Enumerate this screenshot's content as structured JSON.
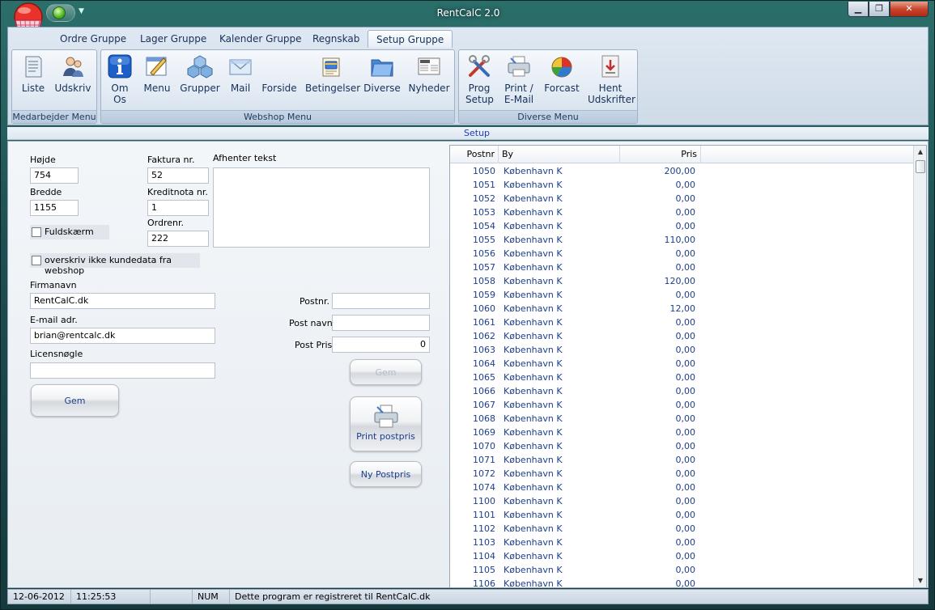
{
  "window": {
    "title": "RentCalC 2.0",
    "min_glyph": "▁",
    "max_glyph": "❐",
    "close_glyph": "✕",
    "qat_drop_glyph": "▼"
  },
  "ribbon": {
    "tabs": [
      "Ordre Gruppe",
      "Lager Gruppe",
      "Kalender Gruppe",
      "Regnskab",
      "Setup Gruppe"
    ],
    "active_tab": "Setup Gruppe",
    "groups": {
      "medarbejder": {
        "label": "Medarbejder Menu",
        "buttons": [
          "Liste",
          "Udskriv"
        ]
      },
      "webshop": {
        "label": "Webshop Menu",
        "buttons": [
          "Om Os",
          "Menu",
          "Grupper",
          "Mail",
          "Forside",
          "Betingelser",
          "Diverse",
          "Nyheder"
        ]
      },
      "diverse": {
        "label": "Diverse Menu",
        "buttons": [
          "Prog Setup",
          "Print / E-Mail",
          "Forcast",
          "Hent Udskrifter"
        ]
      }
    }
  },
  "section_label": "Setup",
  "form": {
    "hojde_label": "Højde",
    "hojde_value": "754",
    "bredde_label": "Bredde",
    "bredde_value": "1155",
    "fuldskaerm_label": "Fuldskærm",
    "faktura_label": "Faktura nr.",
    "faktura_value": "52",
    "kreditnota_label": "Kreditnota nr.",
    "kreditnota_value": "1",
    "ordrenr_label": "Ordrenr.",
    "ordrenr_value": "222",
    "afhenter_label": "Afhenter tekst",
    "afhenter_value": "",
    "overskriv_label": "overskriv ikke kundedata fra webshop",
    "firmanavn_label": "Firmanavn",
    "firmanavn_value": "RentCalC.dk",
    "email_label": "E-mail adr.",
    "email_value": "brian@rentcalc.dk",
    "licens_label": "Licensnøgle",
    "licens_value": "",
    "gem_label": "Gem",
    "postnr_label": "Postnr.",
    "postnr_value": "",
    "postnavn_label": "Post navn",
    "postnavn_value": "",
    "postpris_label": "Post Pris",
    "postpris_value": "0",
    "gem2_label": "Gem",
    "print_postpris_label": "Print postpris",
    "ny_postpris_label": "Ny Postpris"
  },
  "grid": {
    "headers": {
      "postnr": "Postnr",
      "by": "By",
      "pris": "Pris"
    },
    "rows": [
      {
        "postnr": "1050",
        "by": "København K",
        "pris": "200,00"
      },
      {
        "postnr": "1051",
        "by": "København K",
        "pris": "0,00"
      },
      {
        "postnr": "1052",
        "by": "København K",
        "pris": "0,00"
      },
      {
        "postnr": "1053",
        "by": "København K",
        "pris": "0,00"
      },
      {
        "postnr": "1054",
        "by": "København K",
        "pris": "0,00"
      },
      {
        "postnr": "1055",
        "by": "København K",
        "pris": "110,00"
      },
      {
        "postnr": "1056",
        "by": "København K",
        "pris": "0,00"
      },
      {
        "postnr": "1057",
        "by": "København K",
        "pris": "0,00"
      },
      {
        "postnr": "1058",
        "by": "København K",
        "pris": "120,00"
      },
      {
        "postnr": "1059",
        "by": "København K",
        "pris": "0,00"
      },
      {
        "postnr": "1060",
        "by": "København K",
        "pris": "12,00"
      },
      {
        "postnr": "1061",
        "by": "København K",
        "pris": "0,00"
      },
      {
        "postnr": "1062",
        "by": "København K",
        "pris": "0,00"
      },
      {
        "postnr": "1063",
        "by": "København K",
        "pris": "0,00"
      },
      {
        "postnr": "1064",
        "by": "København K",
        "pris": "0,00"
      },
      {
        "postnr": "1065",
        "by": "København K",
        "pris": "0,00"
      },
      {
        "postnr": "1066",
        "by": "København K",
        "pris": "0,00"
      },
      {
        "postnr": "1067",
        "by": "København K",
        "pris": "0,00"
      },
      {
        "postnr": "1068",
        "by": "København K",
        "pris": "0,00"
      },
      {
        "postnr": "1069",
        "by": "København K",
        "pris": "0,00"
      },
      {
        "postnr": "1070",
        "by": "København K",
        "pris": "0,00"
      },
      {
        "postnr": "1071",
        "by": "København K",
        "pris": "0,00"
      },
      {
        "postnr": "1072",
        "by": "København K",
        "pris": "0,00"
      },
      {
        "postnr": "1074",
        "by": "København K",
        "pris": "0,00"
      },
      {
        "postnr": "1100",
        "by": "København K",
        "pris": "0,00"
      },
      {
        "postnr": "1101",
        "by": "København K",
        "pris": "0,00"
      },
      {
        "postnr": "1102",
        "by": "København K",
        "pris": "0,00"
      },
      {
        "postnr": "1103",
        "by": "København K",
        "pris": "0,00"
      },
      {
        "postnr": "1104",
        "by": "København K",
        "pris": "0,00"
      },
      {
        "postnr": "1105",
        "by": "København K",
        "pris": "0,00"
      },
      {
        "postnr": "1106",
        "by": "København K",
        "pris": "0,00"
      }
    ]
  },
  "statusbar": {
    "date": "12-06-2012",
    "time": "11:25:53",
    "num": "NUM",
    "message": "Dette program er registreret til RentCalC.dk"
  }
}
